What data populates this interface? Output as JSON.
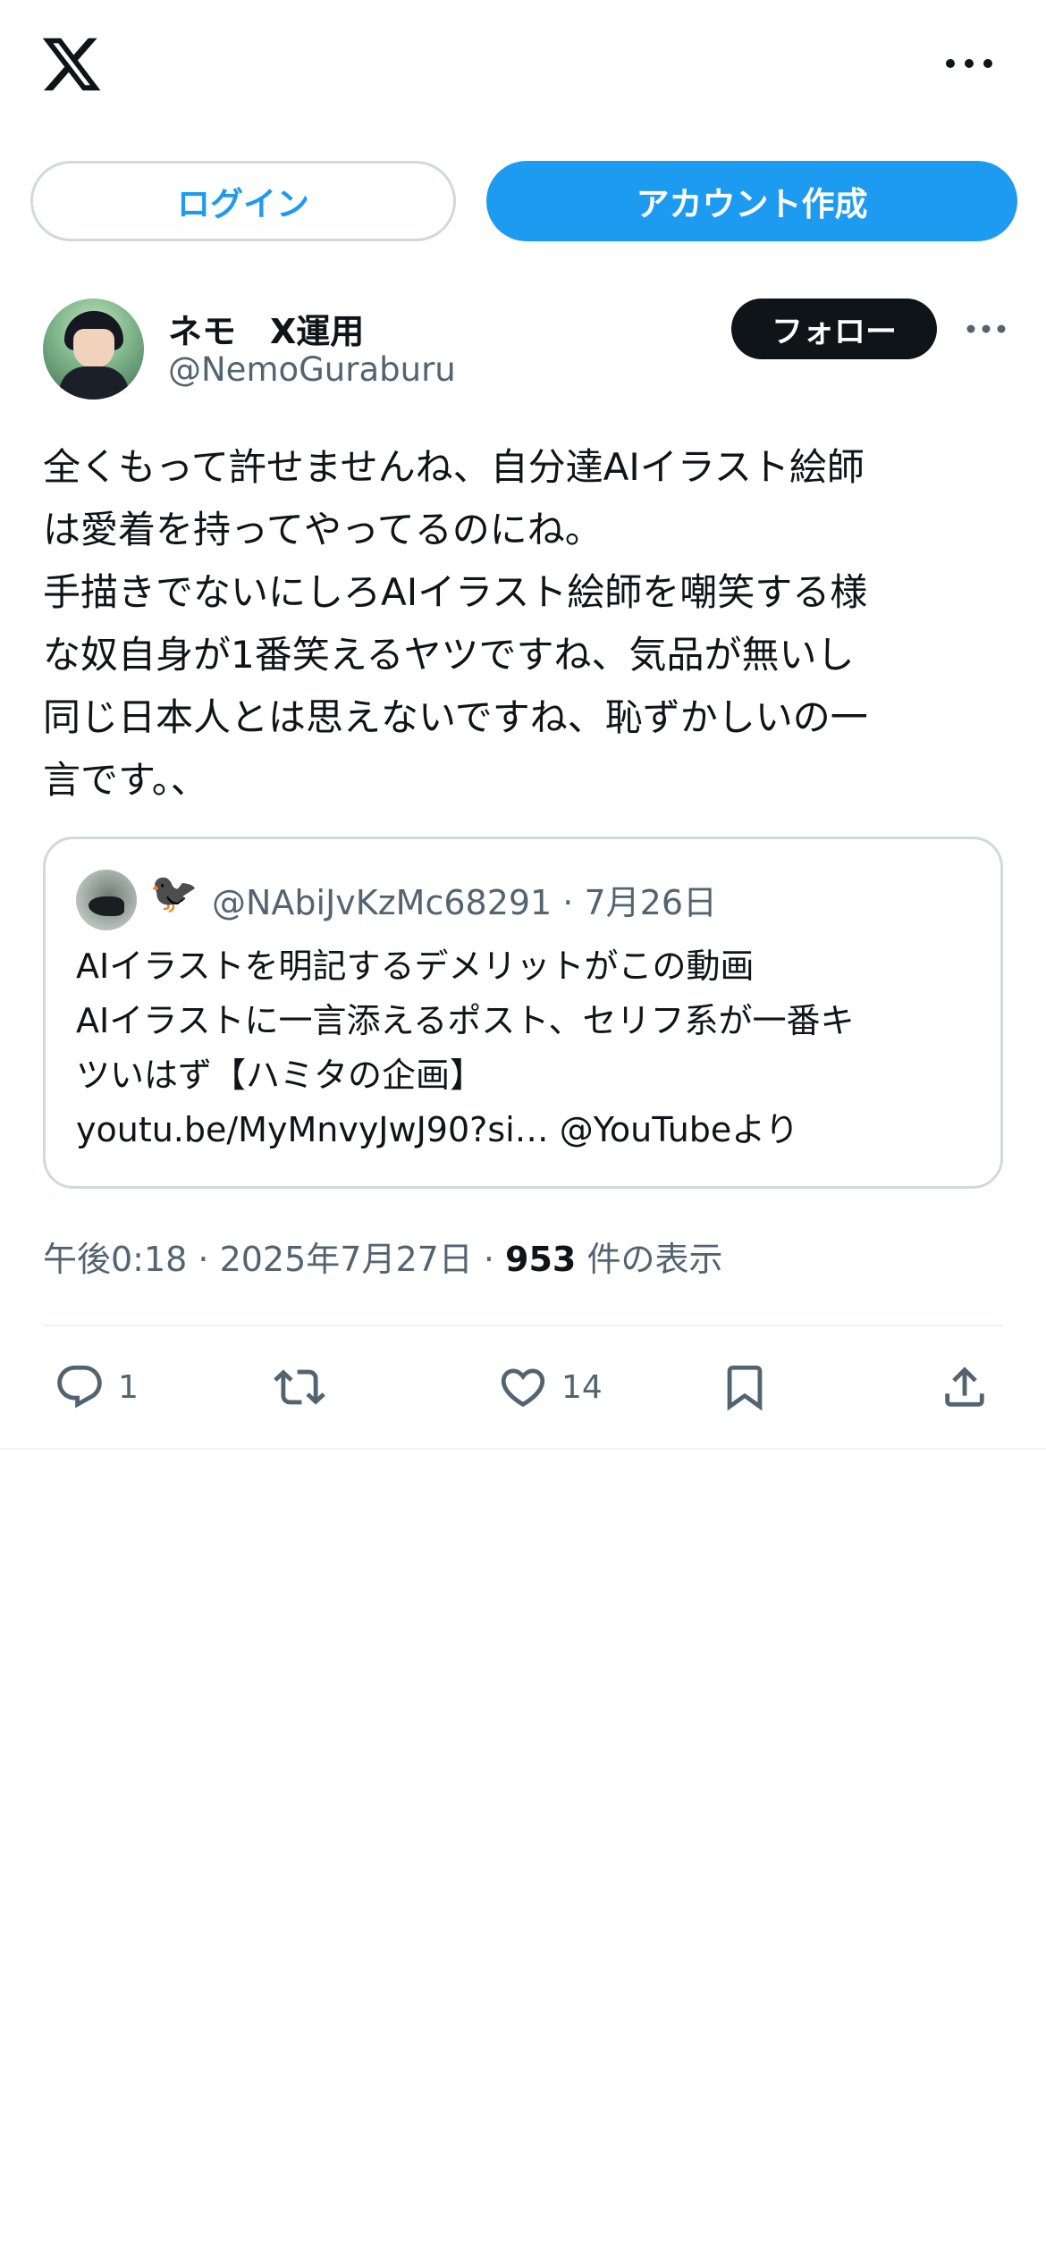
{
  "topbar": {
    "logo": "x-logo-icon",
    "more_icon": "more-horizontal-icon"
  },
  "auth": {
    "login_label": "ログイン",
    "signup_label": "アカウント作成"
  },
  "author": {
    "name": "ネモ　X運用",
    "handle": "@NemoGuraburu",
    "follow_label": "フォロー",
    "more_icon": "more-horizontal-icon"
  },
  "tweet": {
    "text": "全くもって許せませんね、自分達AIイラスト絵師\nは愛着を持ってやってるのにね。\n手描きでないにしろAIイラスト絵師を嘲笑する様\nな奴自身が1番笑えるヤツですね、気品が無いし\n同じ日本人とは思えないですね、恥ずかしいの一\n言です。、"
  },
  "quote": {
    "emoji": "🐦‍⬛",
    "meta": "@NAbiJvKzMc68291 · 7月26日",
    "text": "AIイラストを明記するデメリットがこの動画\nAIイラストに一言添えるポスト、セリフ系が一番キ\nツいはず【ハミタの企画】\nyoutu.be/MyMnvyJwJ90?si… @YouTubeより"
  },
  "meta": {
    "time_date": "午後0:18 · 2025年7月27日 · ",
    "views": "953",
    "views_suffix": " 件の表示"
  },
  "actions": {
    "reply_count": "1",
    "like_count": "14"
  },
  "colors": {
    "accent": "#1d9bf0",
    "text_primary": "#0f1419",
    "text_secondary": "#536471",
    "border": "#cfd9de"
  }
}
